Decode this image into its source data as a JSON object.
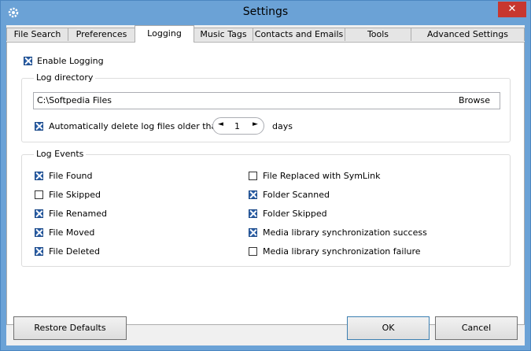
{
  "window": {
    "title": "Settings",
    "close_glyph": "✕",
    "icon": "gear-icon"
  },
  "tabs": [
    {
      "label": "File Search"
    },
    {
      "label": "Preferences"
    },
    {
      "label": "Logging",
      "active": true
    },
    {
      "label": "Music Tags"
    },
    {
      "label": "Contacts and Emails"
    },
    {
      "label": "Tools"
    },
    {
      "label": "Advanced Settings"
    }
  ],
  "logging": {
    "enable_label": "Enable Logging",
    "enable_checked": true,
    "log_directory": {
      "title": "Log directory",
      "path": "C:\\Softpedia Files",
      "browse_label": "Browse",
      "auto_delete_label": "Automatically delete log files older than",
      "auto_delete_checked": true,
      "days_value": "1",
      "days_unit": "days",
      "decrement_glyph": "◄",
      "increment_glyph": "►"
    },
    "log_events": {
      "title": "Log Events",
      "left": [
        {
          "label": "File Found",
          "checked": true
        },
        {
          "label": "File Skipped",
          "checked": false
        },
        {
          "label": "File Renamed",
          "checked": true
        },
        {
          "label": "File Moved",
          "checked": true
        },
        {
          "label": "File Deleted",
          "checked": true
        }
      ],
      "right": [
        {
          "label": "File Replaced with SymLink",
          "checked": false
        },
        {
          "label": "Folder Scanned",
          "checked": true
        },
        {
          "label": "Folder Skipped",
          "checked": true
        },
        {
          "label": "Media library synchronization success",
          "checked": true
        },
        {
          "label": "Media library synchronization failure",
          "checked": false
        }
      ]
    }
  },
  "footer": {
    "restore_label": "Restore Defaults",
    "ok_label": "OK",
    "cancel_label": "Cancel"
  },
  "colors": {
    "titlebar": "#6ba2d6",
    "close": "#c7372f",
    "checkbox": "#2a5ea6"
  }
}
